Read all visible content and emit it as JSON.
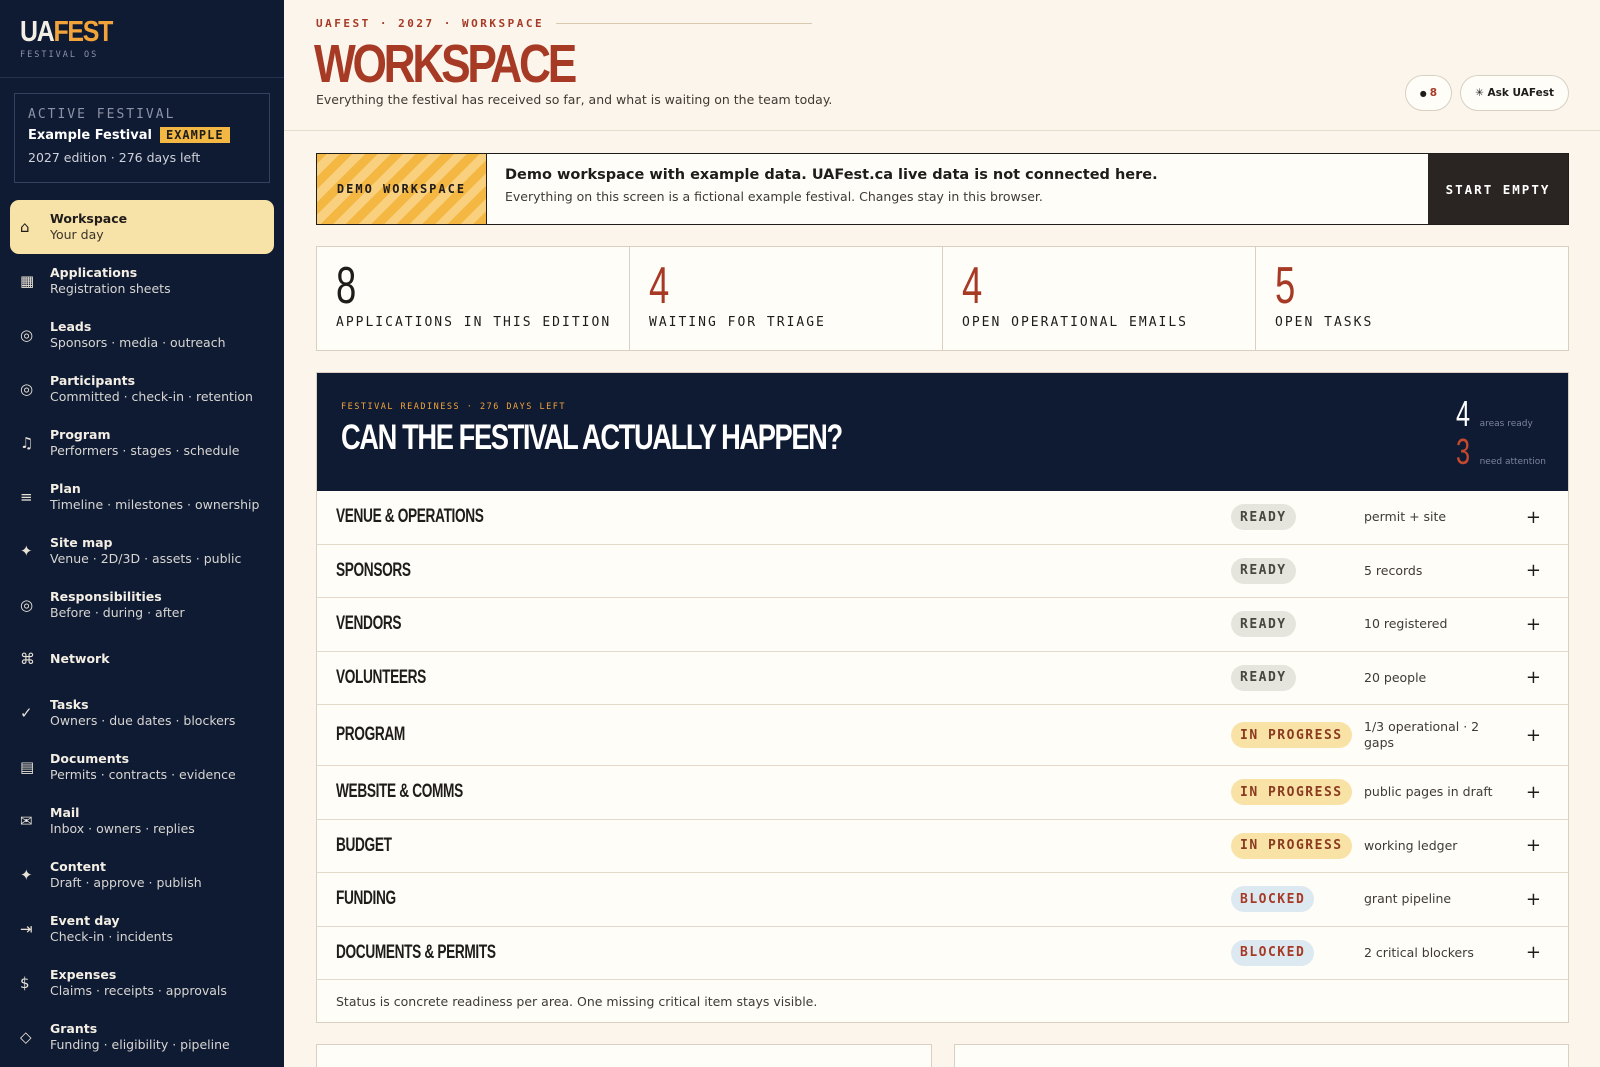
{
  "brand": {
    "logo_a": "UA",
    "logo_b": "FEST",
    "sub": "FESTIVAL OS"
  },
  "festival": {
    "kicker": "ACTIVE FESTIVAL",
    "name": "Example Festival",
    "badge": "EXAMPLE",
    "meta": "2027 edition · 276 days left"
  },
  "nav": [
    {
      "icon": "home-icon",
      "glyph": "⌂",
      "label": "Workspace",
      "sub": "Your day",
      "active": true
    },
    {
      "icon": "grid-icon",
      "glyph": "▦",
      "label": "Applications",
      "sub": "Registration sheets"
    },
    {
      "icon": "target-icon",
      "glyph": "◎",
      "label": "Leads",
      "sub": "Sponsors · media · outreach"
    },
    {
      "icon": "target-icon",
      "glyph": "◎",
      "label": "Participants",
      "sub": "Committed · check-in · retention"
    },
    {
      "icon": "music-note-icon",
      "glyph": "♫",
      "label": "Program",
      "sub": "Performers · stages · schedule"
    },
    {
      "icon": "list-icon",
      "glyph": "≡",
      "label": "Plan",
      "sub": "Timeline · milestones · ownership"
    },
    {
      "icon": "sparkle-icon",
      "glyph": "✦",
      "label": "Site map",
      "sub": "Venue · 2D/3D · assets · public"
    },
    {
      "icon": "target-icon",
      "glyph": "◎",
      "label": "Responsibilities",
      "sub": "Before · during · after"
    },
    {
      "icon": "command-icon",
      "glyph": "⌘",
      "label": "Network",
      "sub": ""
    },
    {
      "icon": "check-icon",
      "glyph": "✓",
      "label": "Tasks",
      "sub": "Owners · due dates · blockers"
    },
    {
      "icon": "document-icon",
      "glyph": "▤",
      "label": "Documents",
      "sub": "Permits · contracts · evidence"
    },
    {
      "icon": "mail-icon",
      "glyph": "✉",
      "label": "Mail",
      "sub": "Inbox · owners · replies"
    },
    {
      "icon": "sparkle-icon",
      "glyph": "✦",
      "label": "Content",
      "sub": "Draft · approve · publish"
    },
    {
      "icon": "arrow-right-bar-icon",
      "glyph": "⇥",
      "label": "Event day",
      "sub": "Check-in · incidents"
    },
    {
      "icon": "dollar-icon",
      "glyph": "$",
      "label": "Expenses",
      "sub": "Claims · receipts · approvals"
    },
    {
      "icon": "diamond-icon",
      "glyph": "◇",
      "label": "Grants",
      "sub": "Funding · eligibility · pipeline"
    }
  ],
  "header": {
    "breadcrumb": "UAFEST · 2027 · WORKSPACE",
    "title": "WORKSPACE",
    "subtitle": "Everything the festival has received so far, and what is waiting on the team today.",
    "notif_dot": "●",
    "notif_count": "8",
    "ask_label": "✳ Ask UAFest"
  },
  "banner": {
    "tag": "DEMO WORKSPACE",
    "title": "Demo workspace with example data. UAFest.ca live data is not connected here.",
    "sub": "Everything on this screen is a fictional example festival. Changes stay in this browser.",
    "button": "START EMPTY"
  },
  "stats": [
    {
      "value": "8",
      "label": "APPLICATIONS IN THIS EDITION",
      "accent": false
    },
    {
      "value": "4",
      "label": "WAITING FOR TRIAGE",
      "accent": true
    },
    {
      "value": "4",
      "label": "OPEN OPERATIONAL EMAILS",
      "accent": true
    },
    {
      "value": "5",
      "label": "OPEN TASKS",
      "accent": true
    }
  ],
  "readiness": {
    "kicker": "FESTIVAL READINESS · 276 DAYS LEFT",
    "title": "CAN THE FESTIVAL ACTUALLY HAPPEN?",
    "ready_count": "4",
    "ready_label": "areas ready",
    "attention_count": "3",
    "attention_label": "need attention",
    "areas": [
      {
        "name": "Venue & Operations",
        "status": "READY",
        "kind": "ready",
        "note": "permit + site"
      },
      {
        "name": "Sponsors",
        "status": "READY",
        "kind": "ready",
        "note": "5 records"
      },
      {
        "name": "Vendors",
        "status": "READY",
        "kind": "ready",
        "note": "10 registered"
      },
      {
        "name": "Volunteers",
        "status": "READY",
        "kind": "ready",
        "note": "20 people"
      },
      {
        "name": "Program",
        "status": "IN PROGRESS",
        "kind": "in-progress",
        "note": "1/3 operational · 2 gaps"
      },
      {
        "name": "Website & Comms",
        "status": "IN PROGRESS",
        "kind": "in-progress",
        "note": "public pages in draft"
      },
      {
        "name": "Budget",
        "status": "IN PROGRESS",
        "kind": "in-progress",
        "note": "working ledger"
      },
      {
        "name": "Funding",
        "status": "BLOCKED",
        "kind": "blocked",
        "note": "grant pipeline"
      },
      {
        "name": "Documents & Permits",
        "status": "BLOCKED",
        "kind": "blocked",
        "note": "2 critical blockers"
      }
    ],
    "expand_glyph": "+",
    "footer": "Status is concrete readiness per area. One missing critical item stays visible."
  },
  "colors": {
    "accent": "#a63a25",
    "navy": "#0f1a33",
    "gold": "#f2a43a"
  }
}
